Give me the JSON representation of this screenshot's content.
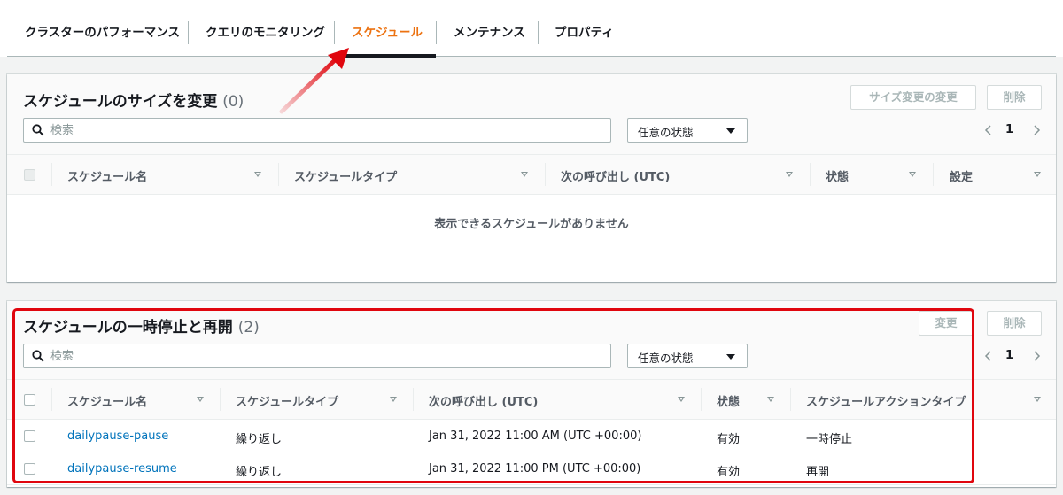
{
  "tabs": [
    {
      "label": "クラスターのパフォーマンス"
    },
    {
      "label": "クエリのモニタリング"
    },
    {
      "label": "スケジュール",
      "active": true
    },
    {
      "label": "メンテナンス"
    },
    {
      "label": "プロパティ"
    }
  ],
  "resize_panel": {
    "title": "スケジュールのサイズを変更",
    "count": "(0)",
    "modify_button": "サイズ変更の変更",
    "delete_button": "削除",
    "search_placeholder": "検索",
    "state_filter": "任意の状態",
    "page": "1",
    "columns": [
      "スケジュール名",
      "スケジュールタイプ",
      "次の呼び出し (UTC)",
      "状態",
      "設定"
    ],
    "empty_message": "表示できるスケジュールがありません"
  },
  "pause_panel": {
    "title": "スケジュールの一時停止と再開",
    "count": "(2)",
    "modify_button": "変更",
    "delete_button": "削除",
    "search_placeholder": "検索",
    "state_filter": "任意の状態",
    "page": "1",
    "columns": [
      "スケジュール名",
      "スケジュールタイプ",
      "次の呼び出し (UTC)",
      "状態",
      "スケジュールアクションタイプ"
    ],
    "rows": [
      {
        "name": "dailypause-pause",
        "type": "繰り返し",
        "next": "Jan 31, 2022 11:00 AM (UTC +00:00)",
        "state": "有効",
        "action": "一時停止"
      },
      {
        "name": "dailypause-resume",
        "type": "繰り返し",
        "next": "Jan 31, 2022 11:00 PM (UTC +00:00)",
        "state": "有効",
        "action": "再開"
      }
    ]
  },
  "colors": {
    "accent": "#ec7211",
    "link": "#0073bb",
    "annotation": "#e0060e"
  },
  "icons": [
    "search-icon",
    "chevron-left-icon",
    "chevron-right-icon",
    "caret-down-icon",
    "sort-icon",
    "annotation-arrow"
  ]
}
